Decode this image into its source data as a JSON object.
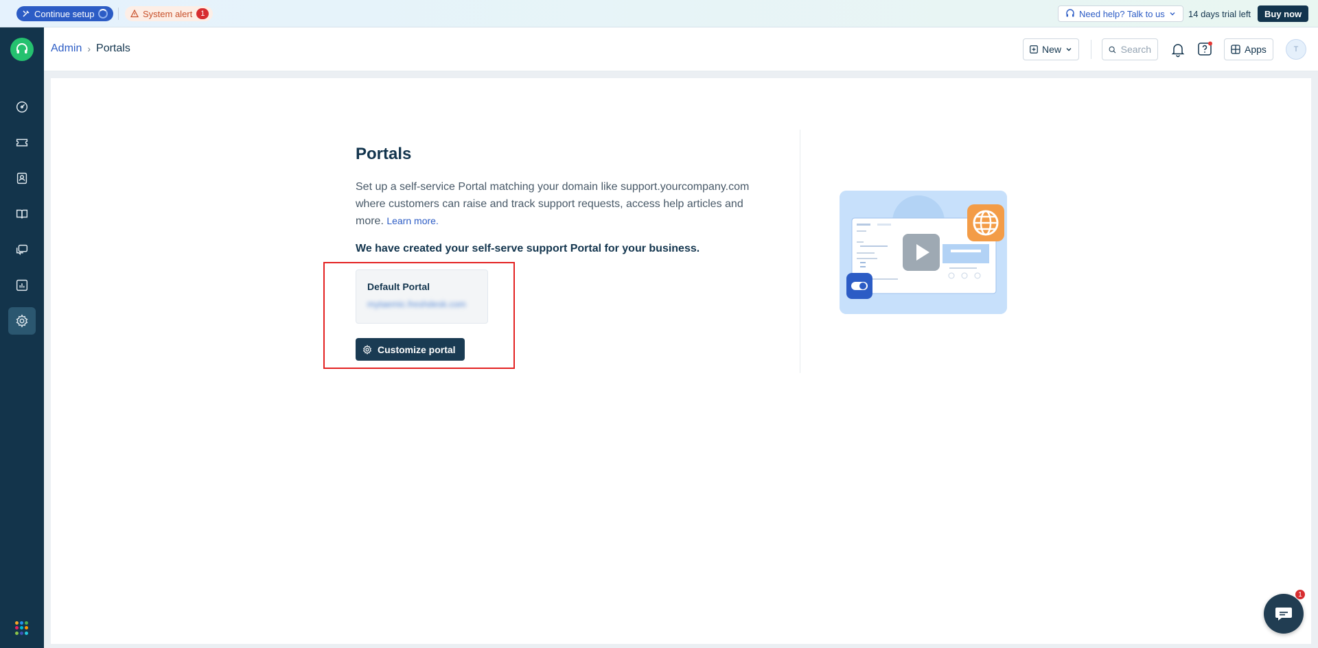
{
  "banner": {
    "continue_setup": "Continue setup",
    "system_alert": "System alert",
    "alert_count": "1",
    "help": "Need help? Talk to us",
    "trial": "14 days trial left",
    "buy_now": "Buy now"
  },
  "sidebar": {
    "logo_icon": "headset-icon",
    "items": [
      {
        "icon": "dashboard-icon",
        "active": false
      },
      {
        "icon": "tickets-icon",
        "active": false
      },
      {
        "icon": "contacts-icon",
        "active": false
      },
      {
        "icon": "solutions-book-icon",
        "active": false
      },
      {
        "icon": "chat-icon",
        "active": false
      },
      {
        "icon": "analytics-icon",
        "active": false
      },
      {
        "icon": "admin-gear-icon",
        "active": true
      }
    ]
  },
  "header": {
    "breadcrumb": {
      "parent": "Admin",
      "separator": "›",
      "current": "Portals"
    },
    "new_label": "New",
    "search_placeholder": "Search",
    "apps_label": "Apps",
    "avatar_initial": "T"
  },
  "main": {
    "title": "Portals",
    "description": "Set up a self-service Portal matching your domain like support.yourcompany.com where customers can raise and track support requests, access help articles and more.",
    "learn_more": "Learn more.",
    "created_message": "We have created your self-serve support Portal for your business.",
    "portal": {
      "name": "Default Portal",
      "url": "mytaemic.freshdesk.com"
    },
    "customize_button": "Customize portal"
  },
  "chat_widget": {
    "badge": "1"
  },
  "colors": {
    "brand_dark": "#12344d",
    "link": "#2c5cc5",
    "highlight": "#e32020",
    "logo_green": "#25c16f"
  }
}
